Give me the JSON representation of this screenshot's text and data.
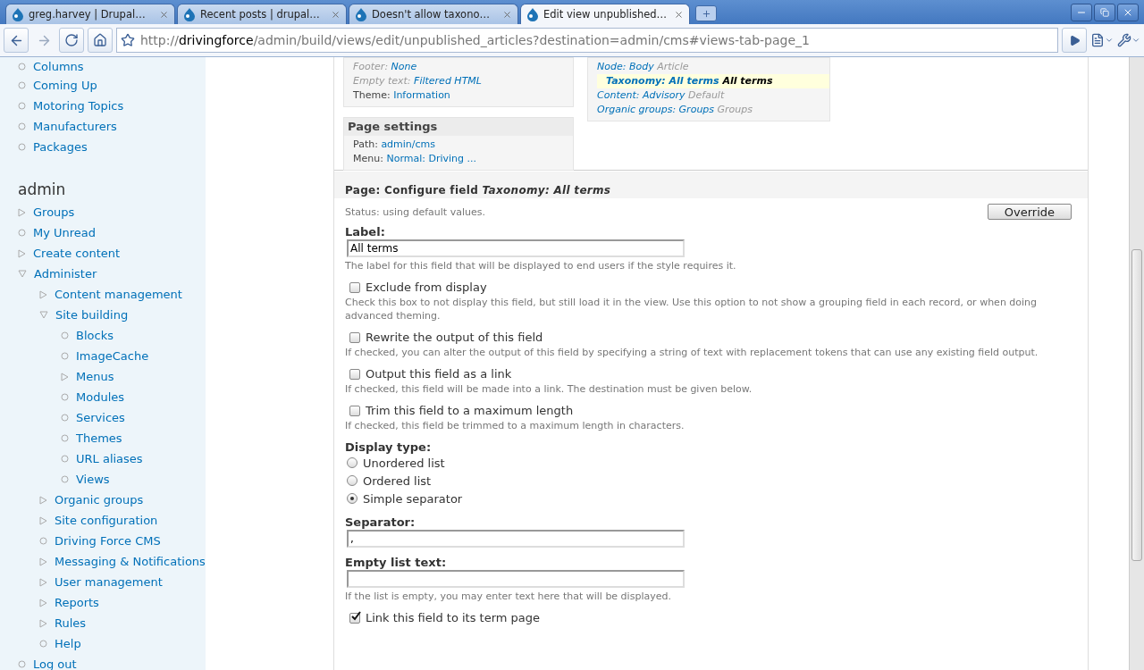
{
  "browser": {
    "tabs": [
      {
        "title": "greg.harvey | Drupal…",
        "selected": false
      },
      {
        "title": "Recent posts | drupal…",
        "selected": false
      },
      {
        "title": "Doesn't allow taxono…",
        "selected": false
      },
      {
        "title": "Edit view unpublished…",
        "selected": true
      }
    ],
    "url": {
      "scheme": "http://",
      "host": "drivingforce",
      "path": "/admin/build/views/edit/unpublished_articles?destination=admin/cms#views-tab-page_1"
    }
  },
  "sidebar": {
    "top_items": [
      {
        "label": "Columns"
      },
      {
        "label": "Coming Up"
      },
      {
        "label": "Motoring Topics"
      },
      {
        "label": "Manufacturers"
      },
      {
        "label": "Packages"
      }
    ],
    "admin_title": "admin",
    "admin_items": [
      {
        "label": "Groups",
        "kind": "collapsed"
      },
      {
        "label": "My Unread",
        "kind": "leaf"
      },
      {
        "label": "Create content",
        "kind": "collapsed"
      },
      {
        "label": "Administer",
        "kind": "expanded",
        "children": [
          {
            "label": "Content management",
            "kind": "collapsed"
          },
          {
            "label": "Site building",
            "kind": "expanded",
            "children": [
              {
                "label": "Blocks",
                "kind": "leaf"
              },
              {
                "label": "ImageCache",
                "kind": "leaf"
              },
              {
                "label": "Menus",
                "kind": "collapsed"
              },
              {
                "label": "Modules",
                "kind": "leaf"
              },
              {
                "label": "Services",
                "kind": "leaf"
              },
              {
                "label": "Themes",
                "kind": "leaf"
              },
              {
                "label": "URL aliases",
                "kind": "leaf"
              },
              {
                "label": "Views",
                "kind": "leaf"
              }
            ]
          },
          {
            "label": "Organic groups",
            "kind": "collapsed"
          },
          {
            "label": "Site configuration",
            "kind": "collapsed"
          },
          {
            "label": "Driving Force CMS",
            "kind": "leaf"
          },
          {
            "label": "Messaging & Notifications",
            "kind": "collapsed"
          },
          {
            "label": "User management",
            "kind": "collapsed"
          },
          {
            "label": "Reports",
            "kind": "collapsed"
          },
          {
            "label": "Rules",
            "kind": "collapsed"
          },
          {
            "label": "Help",
            "kind": "leaf"
          }
        ]
      },
      {
        "label": "Log out",
        "kind": "leaf"
      }
    ]
  },
  "summary": {
    "basic_lines": [
      {
        "label": "Footer:",
        "value": "None",
        "defaulted": true
      },
      {
        "label": "Empty text:",
        "value": "Filtered HTML",
        "defaulted": true
      },
      {
        "label": "Theme:",
        "value": "Information",
        "defaulted": false
      }
    ],
    "page_settings": {
      "title": "Page settings",
      "lines": [
        {
          "label": "Path:",
          "value": "admin/cms"
        },
        {
          "label": "Menu:",
          "value": "Normal: Driving ..."
        }
      ]
    },
    "fields": [
      {
        "name": "Node: Body",
        "label": "Article",
        "selected": false
      },
      {
        "name": "Taxonomy: All terms",
        "label": "All terms",
        "selected": true
      },
      {
        "name": "Content: Advisory",
        "label": "Default",
        "selected": false
      },
      {
        "name": "Organic groups: Groups",
        "label": "Groups",
        "selected": false
      }
    ]
  },
  "config": {
    "title": "Page: Configure field *Taxonomy: All terms*",
    "status": "Status: using default values.",
    "override_button": "Override",
    "items": [
      {
        "kind": "text",
        "label": "Label:",
        "value": "All terms",
        "help": "The label for this field that will be displayed to end users if the style requires it."
      },
      {
        "kind": "checkbox",
        "label": "Exclude from display",
        "checked": false,
        "help": "Check this box to not display this field, but still load it in the view. Use this option to not show a grouping field in each record, or when doing advanced theming."
      },
      {
        "kind": "checkbox",
        "label": "Rewrite the output of this field",
        "checked": false,
        "help": "If checked, you can alter the output of this field by specifying a string of text with replacement tokens that can use any existing field output."
      },
      {
        "kind": "checkbox",
        "label": "Output this field as a link",
        "checked": false,
        "help": "If checked, this field will be made into a link. The destination must be given below."
      },
      {
        "kind": "checkbox",
        "label": "Trim this field to a maximum length",
        "checked": false,
        "help": "If checked, this field be trimmed to a maximum length in characters."
      },
      {
        "kind": "radios",
        "label": "Display type:",
        "options": [
          {
            "label": "Unordered list",
            "selected": false
          },
          {
            "label": "Ordered list",
            "selected": false
          },
          {
            "label": "Simple separator",
            "selected": true
          }
        ]
      },
      {
        "kind": "text",
        "label": "Separator:",
        "value": ","
      },
      {
        "kind": "text",
        "label": "Empty list text:",
        "help": "If the list is empty, you may enter text here that will be displayed."
      },
      {
        "kind": "checkbox",
        "label": "Link this field to its term page",
        "checked": true
      }
    ]
  }
}
